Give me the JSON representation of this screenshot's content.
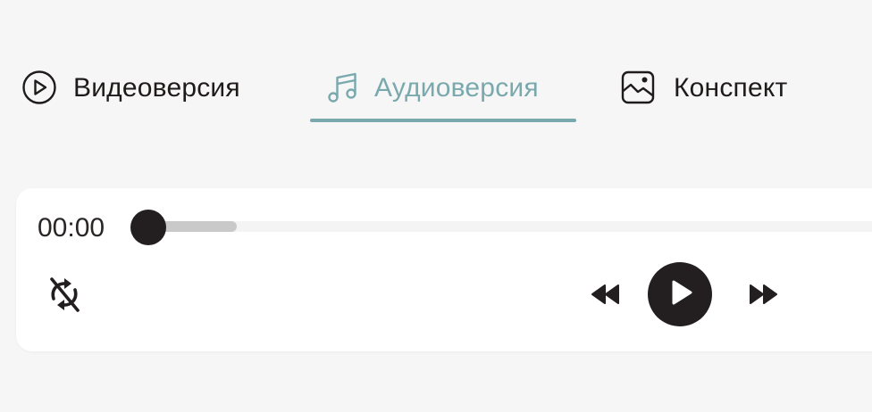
{
  "colors": {
    "accent": "#7aa9ad",
    "text": "#1f1b1b",
    "background": "#f6f6f6",
    "player_background": "#ffffff",
    "control": "#231f20"
  },
  "tabs": [
    {
      "label": "Видеоверсия",
      "icon": "play-circle-icon",
      "active": false
    },
    {
      "label": "Аудиоверсия",
      "icon": "music-note-icon",
      "active": true
    },
    {
      "label": "Конспект",
      "icon": "image-icon",
      "active": false
    }
  ],
  "player": {
    "current_time": "00:00",
    "progress": 0,
    "buffered": 0.12,
    "icons": {
      "repeat": "repeat-off-icon",
      "rewind": "rewind-icon",
      "play": "play-icon",
      "forward": "fast-forward-icon"
    }
  }
}
